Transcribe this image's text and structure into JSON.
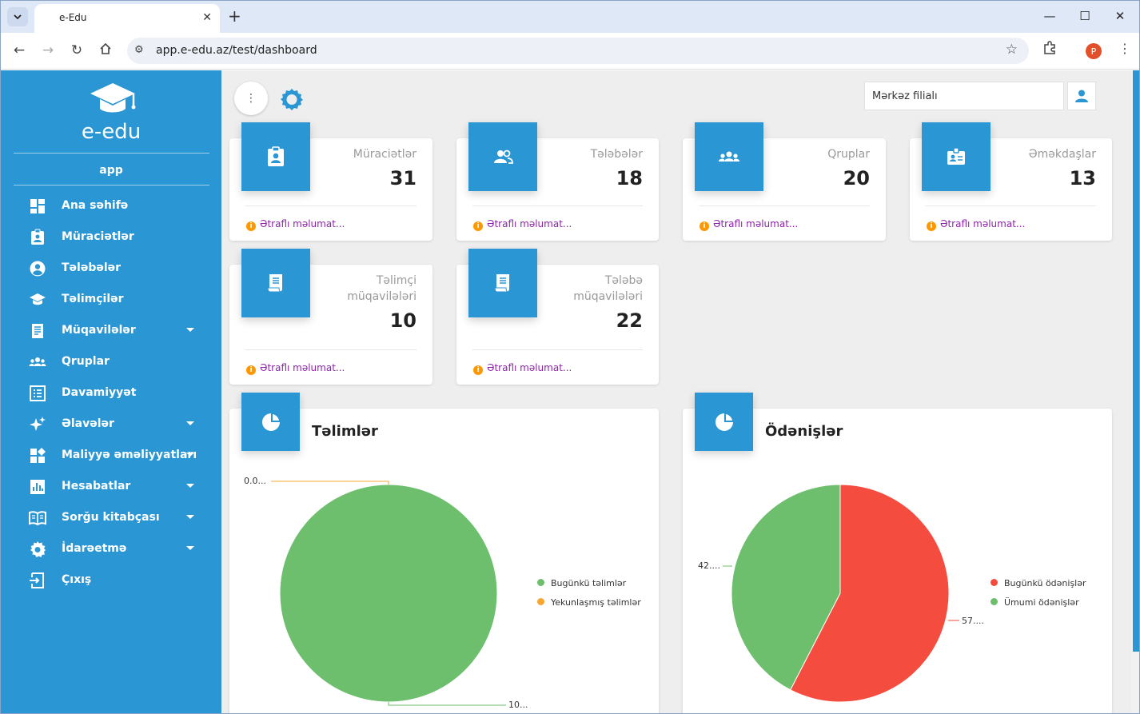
{
  "browser": {
    "tab_title": "e-Edu",
    "url": "app.e-edu.az/test/dashboard",
    "profile_initial": "P"
  },
  "sidebar": {
    "logo_text": "e-edu",
    "user": "app",
    "items": [
      {
        "label": "Ana səhifə",
        "icon": "dashboard-icon",
        "caret": false
      },
      {
        "label": "Müraciətlər",
        "icon": "clipboard-account-icon",
        "caret": false
      },
      {
        "label": "Tələbələr",
        "icon": "account-circle-icon",
        "caret": false
      },
      {
        "label": "Təlimçilər",
        "icon": "school-icon",
        "caret": false
      },
      {
        "label": "Müqavilələr",
        "icon": "contract-icon",
        "caret": true
      },
      {
        "label": "Qruplar",
        "icon": "groups-icon",
        "caret": false
      },
      {
        "label": "Davamiyyət",
        "icon": "list-icon",
        "caret": false
      },
      {
        "label": "Əlavələr",
        "icon": "sparkle-icon",
        "caret": true
      },
      {
        "label": "Maliyyə əməliyyatları",
        "icon": "widgets-icon",
        "caret": true
      },
      {
        "label": "Hesabatlar",
        "icon": "bar-chart-icon",
        "caret": true
      },
      {
        "label": "Sorğu kitabçası",
        "icon": "book-icon",
        "caret": true
      },
      {
        "label": "İdarəetmə",
        "icon": "settings-icon",
        "caret": true
      },
      {
        "label": "Çıxış",
        "icon": "logout-icon",
        "caret": false
      }
    ]
  },
  "header": {
    "branch": "Mərkəz filialı"
  },
  "stats": [
    {
      "label": "Müraciətlər",
      "value": "31",
      "more": "Ətraflı məlumat...",
      "icon": "clipboard-account-icon"
    },
    {
      "label": "Tələbələr",
      "value": "18",
      "more": "Ətraflı məlumat...",
      "icon": "people-icon"
    },
    {
      "label": "Qruplar",
      "value": "20",
      "more": "Ətraflı məlumat...",
      "icon": "groups-icon"
    },
    {
      "label": "Əməkdaşlar",
      "value": "13",
      "more": "Ətraflı məlumat...",
      "icon": "badge-icon"
    },
    {
      "label": "Təlimçi müqavilələri",
      "value": "10",
      "more": "Ətraflı məlumat...",
      "icon": "contract-icon"
    },
    {
      "label": "Tələbə müqavilələri",
      "value": "22",
      "more": "Ətraflı məlumat...",
      "icon": "contract-icon"
    }
  ],
  "charts": {
    "colors": {
      "green": "#6dbf6e",
      "orange": "#f7a731",
      "red": "#f44c3e",
      "accent": "#2a96d4"
    },
    "trainings": {
      "title": "Təlimlər",
      "legend": [
        "Bugünkü təlimlər",
        "Yekunlaşmış təlimlər"
      ],
      "label_small": "0.0...",
      "label_big": "10..."
    },
    "payments": {
      "title": "Ödənişlər",
      "legend": [
        "Bugünkü ödənişlər",
        "Ümumi ödənişlər"
      ],
      "label_green": "42....",
      "label_red": "57...."
    }
  },
  "chart_data": [
    {
      "type": "pie",
      "title": "Təlimlər",
      "categories": [
        "Bugünkü təlimlər",
        "Yekunlaşmış təlimlər"
      ],
      "values": [
        100,
        0
      ]
    },
    {
      "type": "pie",
      "title": "Ödənişlər",
      "categories": [
        "Bugünkü ödənişlər",
        "Ümumi ödənişlər"
      ],
      "values": [
        57,
        42
      ]
    }
  ]
}
